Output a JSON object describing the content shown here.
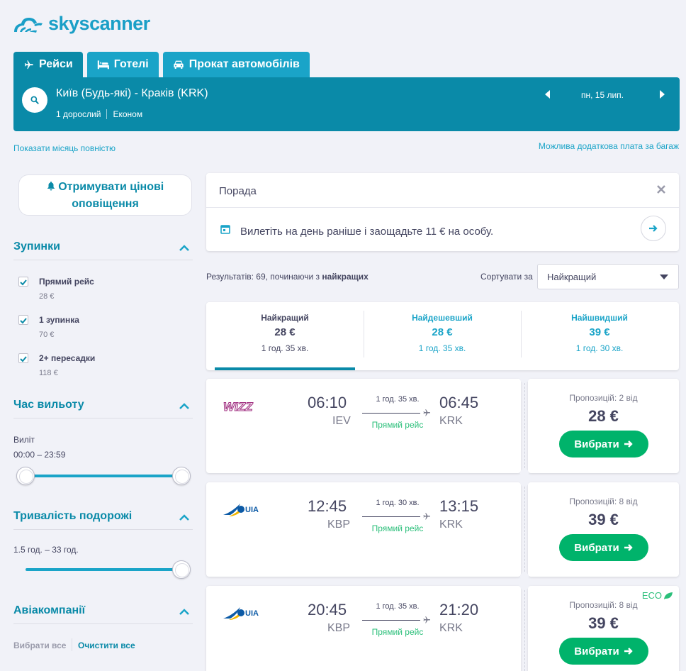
{
  "brand": {
    "name": "skyscanner",
    "color": "#1a9fc7"
  },
  "tabs": [
    {
      "label": "Рейси",
      "icon": "plane-icon"
    },
    {
      "label": "Готелі",
      "icon": "bed-icon"
    },
    {
      "label": "Прокат автомобілів",
      "icon": "car-icon"
    }
  ],
  "search": {
    "route": "Київ (Будь-які) - Краків (KRK)",
    "passengers": "1 дорослий",
    "cabin": "Економ",
    "date": "пн, 15 лип."
  },
  "links": {
    "month": "Показати місяць повністю",
    "baggage": "Можлива додаткова плата за багаж"
  },
  "sidebar": {
    "alerts_label": "Отримувати цінові оповіщення",
    "stops": {
      "title": "Зупинки",
      "items": [
        {
          "label": "Прямий рейс",
          "price": "28 €"
        },
        {
          "label": "1 зупинка",
          "price": "70 €"
        },
        {
          "label": "2+ пересадки",
          "price": "118 €"
        }
      ]
    },
    "departure": {
      "title": "Час вильоту",
      "label": "Виліт",
      "range": "00:00 – 23:59"
    },
    "duration": {
      "title": "Тривалість подорожі",
      "range": "1.5 год. – 33 год."
    },
    "airlines": {
      "title": "Авіакомпанії",
      "select_all": "Вибрати все",
      "clear_all": "Очистити все"
    }
  },
  "tip": {
    "title": "Порада",
    "text": "Вилетіть на день раніше і заощадьте 11 € на особу."
  },
  "results": {
    "prefix": "Результатів: 69, починаючи з ",
    "bold": "найкращих",
    "sort_label": "Сортувати за",
    "sort_value": "Найкращий"
  },
  "sort_tabs": [
    {
      "title": "Найкращий",
      "price": "28 €",
      "duration": "1 год. 35 хв."
    },
    {
      "title": "Найдешевший",
      "price": "28 €",
      "duration": "1 год. 35 хв."
    },
    {
      "title": "Найшвидший",
      "price": "39 €",
      "duration": "1 год. 30 хв."
    }
  ],
  "flights": [
    {
      "airline": "WIZZ",
      "dep_time": "06:10",
      "dep_code": "IEV",
      "arr_time": "06:45",
      "arr_code": "KRK",
      "duration": "1 год. 35 хв.",
      "type": "Прямий рейс",
      "offers": "Пропозицій: 2 від",
      "price": "28 €",
      "button": "Вибрати",
      "eco": ""
    },
    {
      "airline": "UIA",
      "dep_time": "12:45",
      "dep_code": "KBP",
      "arr_time": "13:15",
      "arr_code": "KRK",
      "duration": "1 год. 30 хв.",
      "type": "Прямий рейс",
      "offers": "Пропозицій: 8 від",
      "price": "39 €",
      "button": "Вибрати",
      "eco": ""
    },
    {
      "airline": "UIA",
      "dep_time": "20:45",
      "dep_code": "KBP",
      "arr_time": "21:20",
      "arr_code": "KRK",
      "duration": "1 год. 35 хв.",
      "type": "Прямий рейс",
      "offers": "Пропозицій: 8 від",
      "price": "39 €",
      "button": "Вибрати",
      "eco": "ECO"
    }
  ],
  "colors": {
    "primary": "#0a8aa8",
    "accent": "#1aa4c8",
    "cta": "#00b36b",
    "direct": "#2bbf7a"
  }
}
